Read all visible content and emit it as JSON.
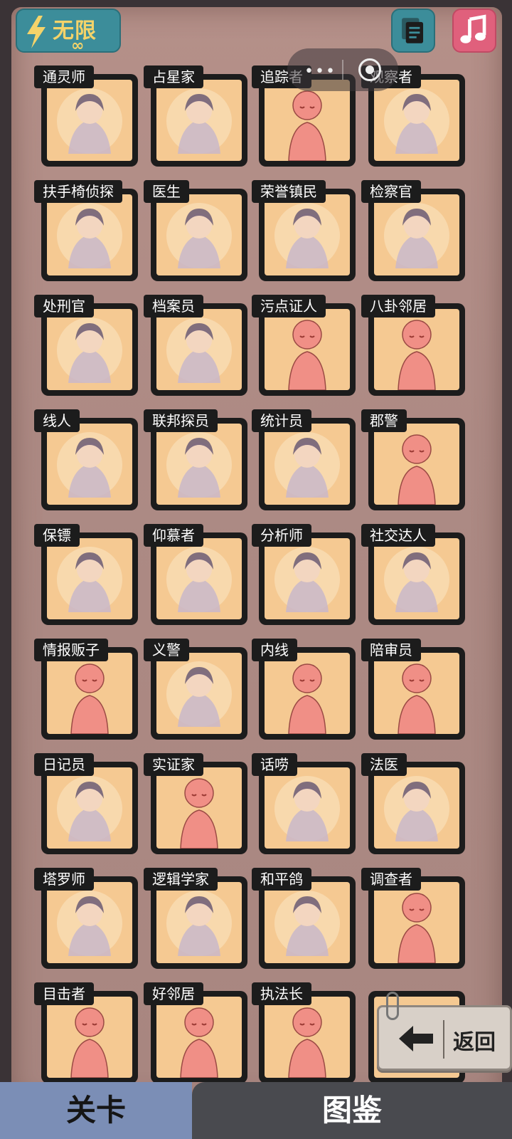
{
  "top_bar": {
    "energy_label": "无限",
    "energy_value": "∞",
    "docs_icon": "documents-icon",
    "music_icon": "music-note-icon"
  },
  "cards": [
    {
      "label": "通灵师",
      "art": "portrait"
    },
    {
      "label": "占星家",
      "art": "portrait"
    },
    {
      "label": "追踪者",
      "art": "figure"
    },
    {
      "label": "观察者",
      "art": "portrait"
    },
    {
      "label": "扶手椅侦探",
      "art": "portrait"
    },
    {
      "label": "医生",
      "art": "portrait"
    },
    {
      "label": "荣誉镇民",
      "art": "portrait"
    },
    {
      "label": "检察官",
      "art": "portrait"
    },
    {
      "label": "处刑官",
      "art": "portrait"
    },
    {
      "label": "档案员",
      "art": "portrait"
    },
    {
      "label": "污点证人",
      "art": "figure"
    },
    {
      "label": "八卦邻居",
      "art": "figure"
    },
    {
      "label": "线人",
      "art": "portrait"
    },
    {
      "label": "联邦探员",
      "art": "portrait"
    },
    {
      "label": "统计员",
      "art": "portrait"
    },
    {
      "label": "郡警",
      "art": "figure"
    },
    {
      "label": "保镖",
      "art": "portrait"
    },
    {
      "label": "仰慕者",
      "art": "portrait"
    },
    {
      "label": "分析师",
      "art": "portrait"
    },
    {
      "label": "社交达人",
      "art": "portrait"
    },
    {
      "label": "情报贩子",
      "art": "figure"
    },
    {
      "label": "义警",
      "art": "portrait"
    },
    {
      "label": "内线",
      "art": "figure"
    },
    {
      "label": "陪审员",
      "art": "figure"
    },
    {
      "label": "日记员",
      "art": "portrait"
    },
    {
      "label": "实证家",
      "art": "figure"
    },
    {
      "label": "话唠",
      "art": "portrait"
    },
    {
      "label": "法医",
      "art": "portrait"
    },
    {
      "label": "塔罗师",
      "art": "portrait"
    },
    {
      "label": "逻辑学家",
      "art": "portrait"
    },
    {
      "label": "和平鸽",
      "art": "portrait"
    },
    {
      "label": "调查者",
      "art": "figure"
    },
    {
      "label": "目击者",
      "art": "figure"
    },
    {
      "label": "好邻居",
      "art": "figure"
    },
    {
      "label": "执法长",
      "art": "figure"
    },
    {
      "label": "",
      "art": "portrait"
    }
  ],
  "back_button": {
    "label": "返回"
  },
  "tabs": [
    {
      "label": "关卡",
      "active": true
    },
    {
      "label": "图鉴",
      "active": false
    }
  ],
  "colors": {
    "paper": "#b08c86",
    "card_inner": "#f5c992",
    "figure": "#f08f86",
    "accent_teal": "#3c8d9a",
    "tab_active": "#7b8eb6",
    "tab_inactive": "#494a4f"
  }
}
